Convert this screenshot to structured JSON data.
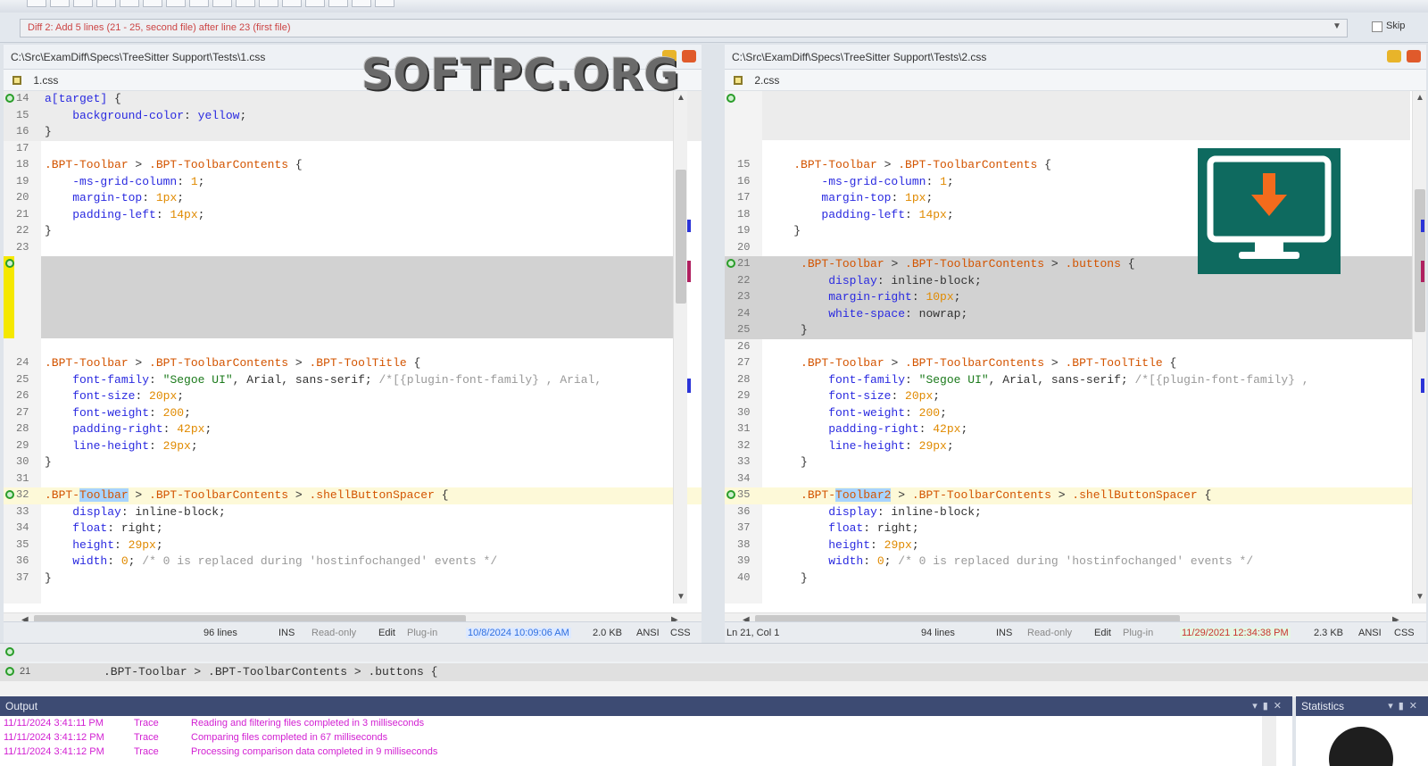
{
  "diffbar": {
    "description": "Diff 2: Add 5 lines (21 - 25, second file) after line 23 (first file)",
    "skip_label": "Skip"
  },
  "left": {
    "path": "C:\\Src\\ExamDiff\\Specs\\TreeSitter Support\\Tests\\1.css",
    "file_name": "1.css",
    "status": {
      "lines": "96 lines",
      "ins": "INS",
      "readonly": "Read-only",
      "edit": "Edit",
      "plugin": "Plug-in",
      "date": "10/8/2024 10:09:06 AM",
      "size": "2.0 KB",
      "encoding": "ANSI",
      "syntax": "CSS"
    }
  },
  "right": {
    "path": "C:\\Src\\ExamDiff\\Specs\\TreeSitter Support\\Tests\\2.css",
    "file_name": "2.css",
    "status": {
      "position": "Ln 21, Col 1",
      "lines": "94 lines",
      "ins": "INS",
      "readonly": "Read-only",
      "edit": "Edit",
      "plugin": "Plug-in",
      "date": "11/29/2021 12:34:38 PM",
      "size": "2.3 KB",
      "encoding": "ANSI",
      "syntax": "CSS"
    }
  },
  "merge": {
    "line_number": "21",
    "text": ".BPT-Toolbar > .BPT-ToolbarContents > .buttons {"
  },
  "output": {
    "title": "Output",
    "rows": [
      {
        "time": "11/11/2024 3:41:11 PM",
        "level": "Trace",
        "message": "Reading and filtering files completed in 3 milliseconds"
      },
      {
        "time": "11/11/2024 3:41:12 PM",
        "level": "Trace",
        "message": "Comparing files completed in 67 milliseconds"
      },
      {
        "time": "11/11/2024 3:41:12 PM",
        "level": "Trace",
        "message": "Processing comparison data completed in 9 milliseconds"
      }
    ]
  },
  "statistics": {
    "title": "Statistics"
  },
  "watermark": "SOFTPC.ORG",
  "icons": {
    "download_badge": "monitor-download-icon",
    "file_icon": "css-file-icon",
    "diff_marker": "diff-circle-icon"
  },
  "colors": {
    "added_block": "#d2d2d2",
    "current_line": "#fdf9d8",
    "yellow_marker": "#f5e800",
    "output_text": "#d21fd2",
    "panel_header": "#3d4b73",
    "badge": "#0e6a5f",
    "badge_arrow": "#f36b1c"
  }
}
